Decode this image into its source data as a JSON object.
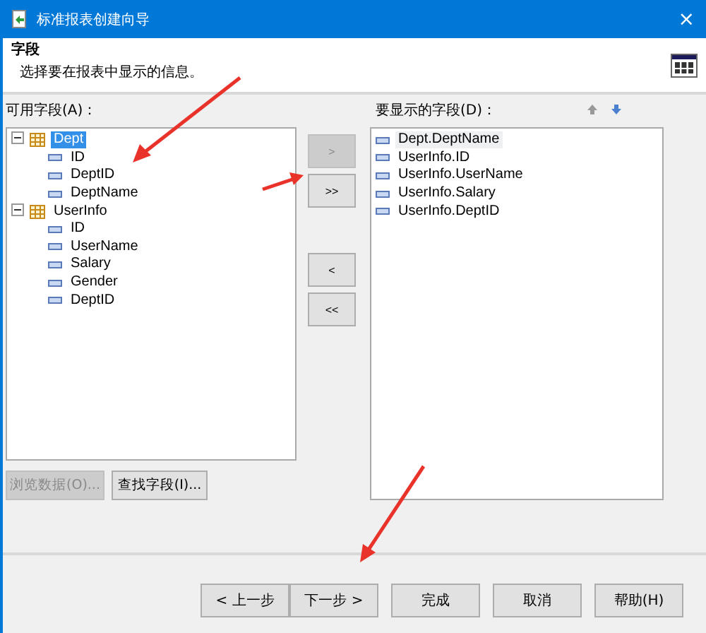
{
  "window": {
    "title": "标准报表创建向导",
    "close": "×"
  },
  "header": {
    "title": "字段",
    "subtitle": "选择要在报表中显示的信息。"
  },
  "available": {
    "label": "可用字段(A)：",
    "tree": [
      {
        "label": "Dept",
        "expanded": true,
        "selected": true,
        "children": [
          {
            "label": "ID",
            "selected": false
          },
          {
            "label": "DeptID",
            "selected": false
          },
          {
            "label": "DeptName",
            "selected": false
          }
        ]
      },
      {
        "label": "UserInfo",
        "expanded": true,
        "selected": false,
        "children": [
          {
            "label": "ID",
            "selected": false
          },
          {
            "label": "UserName",
            "selected": false
          },
          {
            "label": "Salary",
            "selected": false
          },
          {
            "label": "Gender",
            "selected": false
          },
          {
            "label": "DeptID",
            "selected": false
          }
        ]
      }
    ]
  },
  "move_buttons": [
    {
      "label": ">",
      "disabled": true
    },
    {
      "label": ">>",
      "disabled": false
    },
    {
      "label": "<",
      "disabled": false
    },
    {
      "label": "<<",
      "disabled": false
    }
  ],
  "displayed": {
    "label": "要显示的字段(D)：",
    "items": [
      {
        "label": "Dept.DeptName",
        "selected": true
      },
      {
        "label": "UserInfo.ID",
        "selected": false
      },
      {
        "label": "UserInfo.UserName",
        "selected": false
      },
      {
        "label": "UserInfo.Salary",
        "selected": false
      },
      {
        "label": "UserInfo.DeptID",
        "selected": false
      }
    ]
  },
  "list_buttons": [
    {
      "label": "浏览数据(O)...",
      "disabled": true
    },
    {
      "label": "查找字段(I)...",
      "disabled": false
    }
  ],
  "footer_buttons": [
    {
      "label": "< 上一步",
      "disabled": false
    },
    {
      "label": "下一步 >",
      "disabled": false
    },
    {
      "label": "完成",
      "disabled": false
    },
    {
      "label": "取消",
      "disabled": false
    },
    {
      "label": "帮助(H)",
      "disabled": false
    }
  ]
}
